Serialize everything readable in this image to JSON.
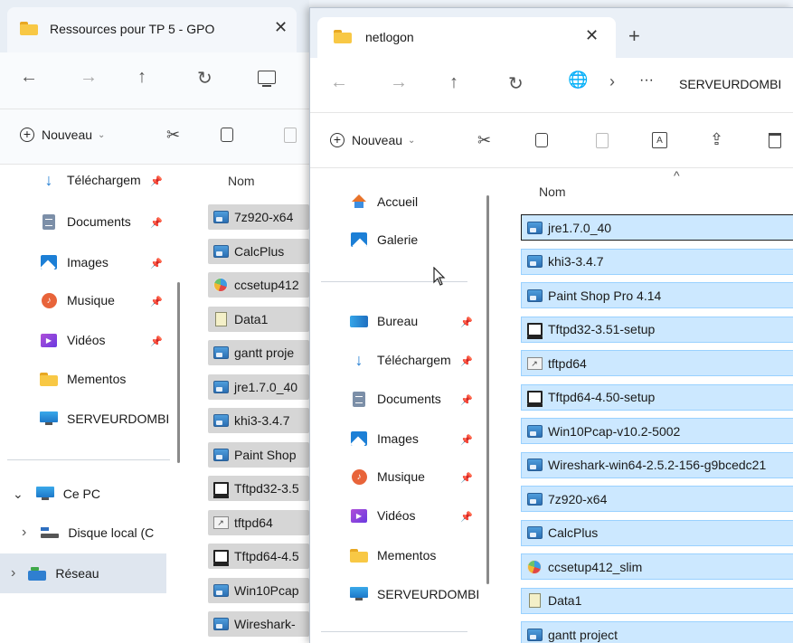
{
  "window_back": {
    "tab": {
      "title": "Ressources pour TP 5 - GPO",
      "close": "✕"
    },
    "nav": {
      "back": "←",
      "forward": "→",
      "up": "↑",
      "refresh": "↻"
    },
    "cmd": {
      "new_label": "Nouveau",
      "new_plus": "+",
      "new_chev": "⌄"
    },
    "sidebar": {
      "items": [
        {
          "label": "Téléchargem",
          "icon": "download-icon",
          "pinned": true
        },
        {
          "label": "Documents",
          "icon": "documents-icon",
          "pinned": true
        },
        {
          "label": "Images",
          "icon": "images-icon",
          "pinned": true
        },
        {
          "label": "Musique",
          "icon": "music-icon",
          "pinned": true
        },
        {
          "label": "Vidéos",
          "icon": "videos-icon",
          "pinned": true
        },
        {
          "label": "Mementos",
          "icon": "folder-icon",
          "pinned": false
        },
        {
          "label": "SERVEURDOMBI",
          "icon": "monitor-icon",
          "pinned": false
        }
      ],
      "this_pc": "Ce PC",
      "local_disk": "Disque local (C",
      "network": "Réseau",
      "expand_open": "⌄",
      "expand_closed": "›"
    },
    "column_name": "Nom",
    "files": [
      {
        "name": "7z920-x64",
        "type": "app"
      },
      {
        "name": "CalcPlus",
        "type": "app"
      },
      {
        "name": "ccsetup412",
        "type": "cc"
      },
      {
        "name": "Data1",
        "type": "data"
      },
      {
        "name": "gantt proje",
        "type": "app"
      },
      {
        "name": "jre1.7.0_40",
        "type": "app"
      },
      {
        "name": "khi3-3.4.7",
        "type": "app"
      },
      {
        "name": "Paint Shop",
        "type": "app"
      },
      {
        "name": "Tftpd32-3.5",
        "type": "setup"
      },
      {
        "name": "tftpd64",
        "type": "shortcut"
      },
      {
        "name": "Tftpd64-4.5",
        "type": "setup"
      },
      {
        "name": "Win10Pcap",
        "type": "app"
      },
      {
        "name": "Wireshark-",
        "type": "app"
      }
    ]
  },
  "window_front": {
    "tab": {
      "title": "netlogon",
      "close": "✕"
    },
    "new_tab": "+",
    "nav": {
      "back": "←",
      "forward": "→",
      "up": "↑",
      "refresh": "↻",
      "more": "···",
      "sep": "›",
      "path": "SERVEURDOMBI"
    },
    "cmd": {
      "new_label": "Nouveau",
      "new_plus": "+",
      "new_chev": "⌄"
    },
    "sidebar": {
      "top": [
        {
          "label": "Accueil",
          "icon": "home-icon"
        },
        {
          "label": "Galerie",
          "icon": "gallery-icon"
        }
      ],
      "items": [
        {
          "label": "Bureau",
          "icon": "desktop-icon",
          "pinned": true
        },
        {
          "label": "Téléchargem",
          "icon": "download-icon",
          "pinned": true
        },
        {
          "label": "Documents",
          "icon": "documents-icon",
          "pinned": true
        },
        {
          "label": "Images",
          "icon": "images-icon",
          "pinned": true
        },
        {
          "label": "Musique",
          "icon": "music-icon",
          "pinned": true
        },
        {
          "label": "Vidéos",
          "icon": "videos-icon",
          "pinned": true
        },
        {
          "label": "Mementos",
          "icon": "folder-icon",
          "pinned": false
        },
        {
          "label": "SERVEURDOMBI",
          "icon": "monitor-icon",
          "pinned": false
        }
      ]
    },
    "column_name": "Nom",
    "sort_indicator": "^",
    "files": [
      {
        "name": "jre1.7.0_40",
        "type": "app",
        "focus": true
      },
      {
        "name": "khi3-3.4.7",
        "type": "app"
      },
      {
        "name": "Paint Shop Pro 4.14",
        "type": "app"
      },
      {
        "name": "Tftpd32-3.51-setup",
        "type": "setup"
      },
      {
        "name": "tftpd64",
        "type": "shortcut"
      },
      {
        "name": "Tftpd64-4.50-setup",
        "type": "setup"
      },
      {
        "name": "Win10Pcap-v10.2-5002",
        "type": "app"
      },
      {
        "name": "Wireshark-win64-2.5.2-156-g9bcedc21",
        "type": "app"
      },
      {
        "name": "7z920-x64",
        "type": "app"
      },
      {
        "name": "CalcPlus",
        "type": "app"
      },
      {
        "name": "ccsetup412_slim",
        "type": "cc"
      },
      {
        "name": "Data1",
        "type": "data"
      },
      {
        "name": "gantt project",
        "type": "app"
      }
    ]
  },
  "colors": {
    "selection": "#cce8ff",
    "selection_border": "#99d1ff",
    "back_selection": "#d6d6d6",
    "folder": "#f8c845"
  }
}
